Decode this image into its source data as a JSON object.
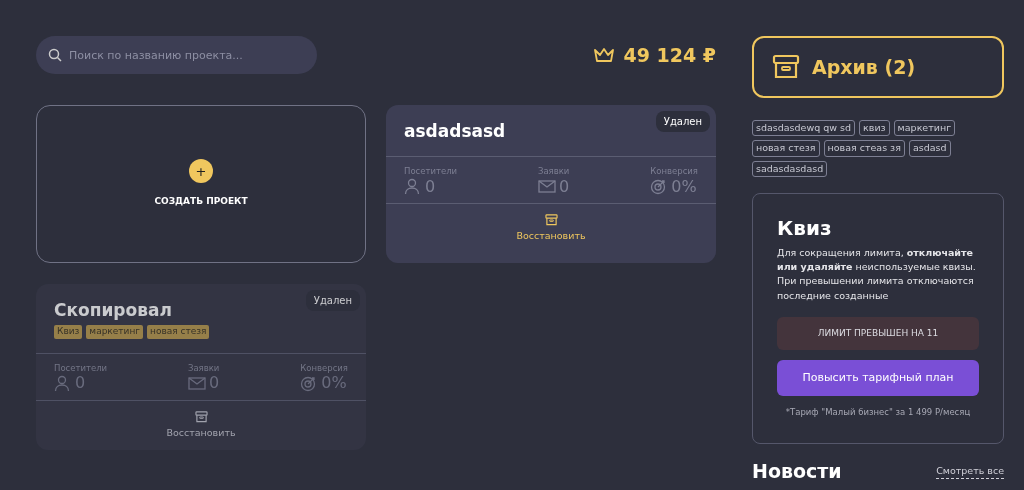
{
  "search": {
    "placeholder": "Поиск по названию проекта..."
  },
  "balance": {
    "amount": "49 124 ₽"
  },
  "projects": [
    {
      "kind": "create",
      "label": "СОЗДАТЬ ПРОЕКТ",
      "icon": "+"
    },
    {
      "kind": "project",
      "title": "asdadsasd",
      "status": "Удален",
      "dimmed": false,
      "stats": [
        {
          "kind": "visitors",
          "label": "Посетители",
          "value": "0"
        },
        {
          "kind": "leads",
          "label": "Заявки",
          "value": "0"
        },
        {
          "kind": "conversion",
          "label": "Конверсия",
          "value": "0%"
        }
      ],
      "action": "Восстановить"
    },
    {
      "kind": "project",
      "title": "Скопировал",
      "status": "Удален",
      "dimmed": true,
      "tags": [
        "Квиз",
        "маркетинг",
        "новая стезя"
      ],
      "stats": [
        {
          "kind": "visitors",
          "label": "Посетители",
          "value": "0"
        },
        {
          "kind": "leads",
          "label": "Заявки",
          "value": "0"
        },
        {
          "kind": "conversion",
          "label": "Конверсия",
          "value": "0%"
        }
      ],
      "action": "Восстановить"
    }
  ],
  "archive": {
    "label": "Архив (2)"
  },
  "tags": [
    "sdasdasdewq qw sd",
    "квиз",
    "маркетинг",
    "новая стезя",
    "новая стеas зя",
    "asdasd",
    "sadasdasdasd"
  ],
  "quiz": {
    "title": "Квиз",
    "text": "Для сокращения лимита, **отключайте или удаляйте** неиспользуемые квизы. При превышении лимита отключаются последние созданные",
    "alert": "ЛИМИТ ПРЕВЫШЕН НА 11",
    "button": "Повысить тарифный план",
    "note": "*Тариф \"Малый бизнес\" за 1 499 Р/месяц"
  },
  "news": {
    "title": "Новости",
    "link": "Смотреть все"
  }
}
